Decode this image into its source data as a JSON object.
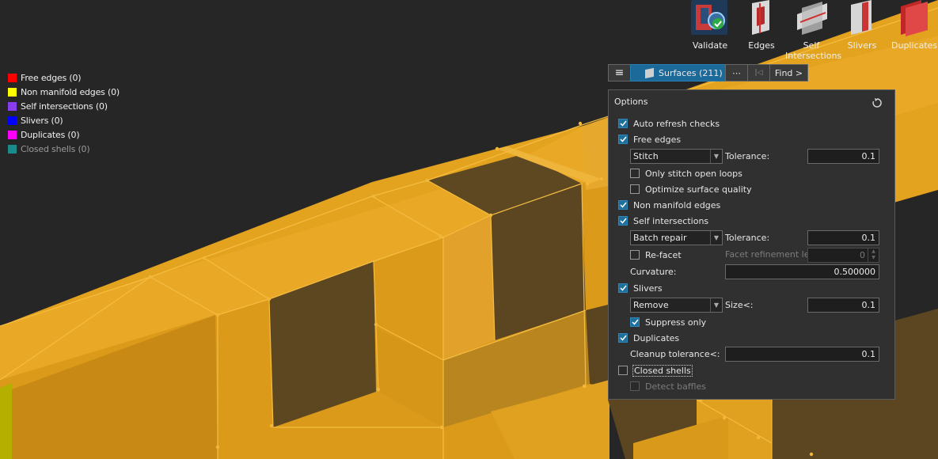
{
  "legend": [
    {
      "label": "Free edges (0)",
      "color": "#ff0000"
    },
    {
      "label": "Non manifold edges (0)",
      "color": "#ffff00"
    },
    {
      "label": "Self intersections (0)",
      "color": "#8a2be2"
    },
    {
      "label": "Slivers (0)",
      "color": "#0000ff"
    },
    {
      "label": "Duplicates (0)",
      "color": "#ff00ff"
    },
    {
      "label": "Closed shells (0)",
      "color": "#008b8b"
    }
  ],
  "toolbar": {
    "validate": "Validate",
    "edges": "Edges",
    "self_intersections_1": "Self",
    "self_intersections_2": "Intersections",
    "slivers": "Slivers",
    "duplicates": "Duplicates"
  },
  "bar": {
    "menu": "≡",
    "surfaces": "Surfaces (211)",
    "more": "⋯",
    "first": "|◁",
    "find": "Find >"
  },
  "options": {
    "title": "Options",
    "auto_refresh": "Auto refresh checks",
    "free_edges": "Free edges",
    "free_edges_method": "Stitch",
    "tolerance_label": "Tolerance:",
    "free_edges_tolerance": "0.1",
    "only_stitch": "Only stitch open loops",
    "optimize": "Optimize surface quality",
    "non_manifold": "Non manifold edges",
    "self_intersections": "Self intersections",
    "self_method": "Batch repair",
    "self_tolerance": "0.1",
    "refacet": "Re-facet",
    "facet_level_label": "Facet refinement level:",
    "facet_level": "0",
    "curvature_label": "Curvature:",
    "curvature": "0.500000",
    "slivers": "Slivers",
    "slivers_method": "Remove",
    "size_label": "Size<:",
    "slivers_size": "0.1",
    "suppress_only": "Suppress only",
    "duplicates": "Duplicates",
    "cleanup_label": "Cleanup tolerance<:",
    "cleanup": "0.1",
    "closed_shells": "Closed shells",
    "detect_baffles": "Detect baffles"
  },
  "colors": {
    "accent": "#1f6f9c",
    "model": "#e3a21d",
    "background": "#262626"
  }
}
